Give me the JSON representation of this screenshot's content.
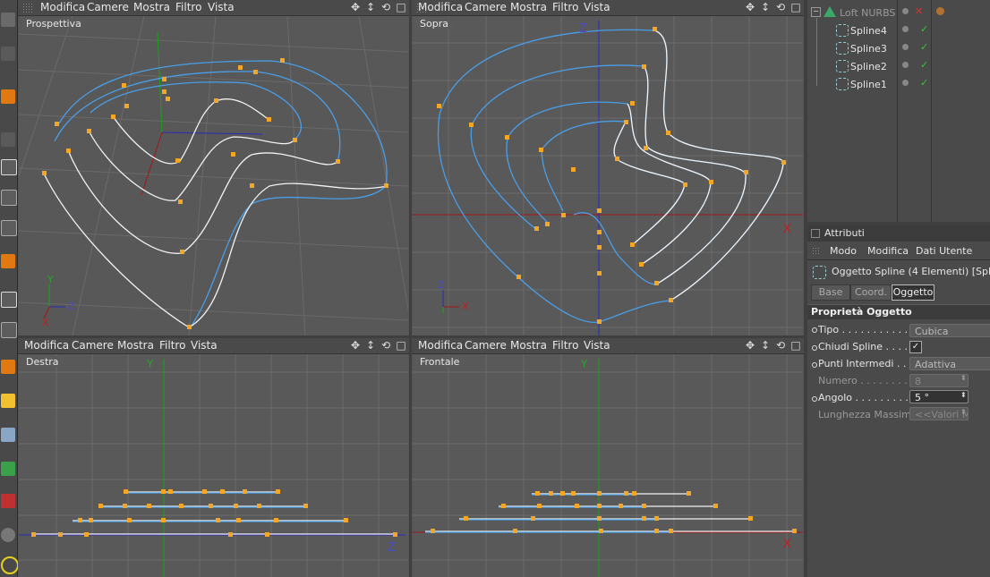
{
  "viewports": {
    "menu": [
      "Modifica",
      "Camere",
      "Mostra",
      "Filtro",
      "Vista"
    ],
    "perspective": {
      "label": "Prospettiva"
    },
    "top": {
      "label": "Sopra",
      "axis_z": "Z",
      "axis_x": "X"
    },
    "right": {
      "label": "Destra",
      "axis_y": "Y",
      "axis_z": "Z"
    },
    "front": {
      "label": "Frontale",
      "axis_y": "Y",
      "axis_x": "X"
    },
    "gizmo": {
      "x": "X",
      "y": "Y",
      "z": "Z"
    }
  },
  "object_manager": {
    "items": [
      {
        "label": "Loft NURBS"
      },
      {
        "label": "Spline4"
      },
      {
        "label": "Spline3"
      },
      {
        "label": "Spline2"
      },
      {
        "label": "Spline1"
      }
    ]
  },
  "attributes": {
    "panel_title": "Attributi",
    "menu": [
      "Modo",
      "Modifica",
      "Dati Utente"
    ],
    "object_header": "Oggetto Spline (4 Elementi) [Spline4,",
    "tabs": [
      "Base",
      "Coord.",
      "Oggetto"
    ],
    "active_tab": "Oggetto",
    "section_title": "Proprietà Oggetto",
    "props": {
      "tipo_label": "Tipo . . . . . . . . . . . .",
      "tipo_value": "Cubica",
      "chiudi_label": "Chiudi Spline . . . . .",
      "chiudi_value": "✓",
      "punti_label": "Punti Intermedi . . . .",
      "punti_value": "Adattiva",
      "numero_label": "Numero . . . . . . . . .",
      "numero_value": "8",
      "angolo_label": "Angolo . . . . . . . . . .",
      "angolo_value": "5 °",
      "lunghezza_label": "Lunghezza Massima",
      "lunghezza_value": "<<Valori M"
    }
  },
  "colors": {
    "spline_white": "#f2f2f2",
    "spline_blue": "#4a9ee8",
    "point": "#f5a623",
    "axis_x": "#a01818",
    "axis_y": "#1aa31a",
    "axis_z": "#2a2ab8"
  }
}
